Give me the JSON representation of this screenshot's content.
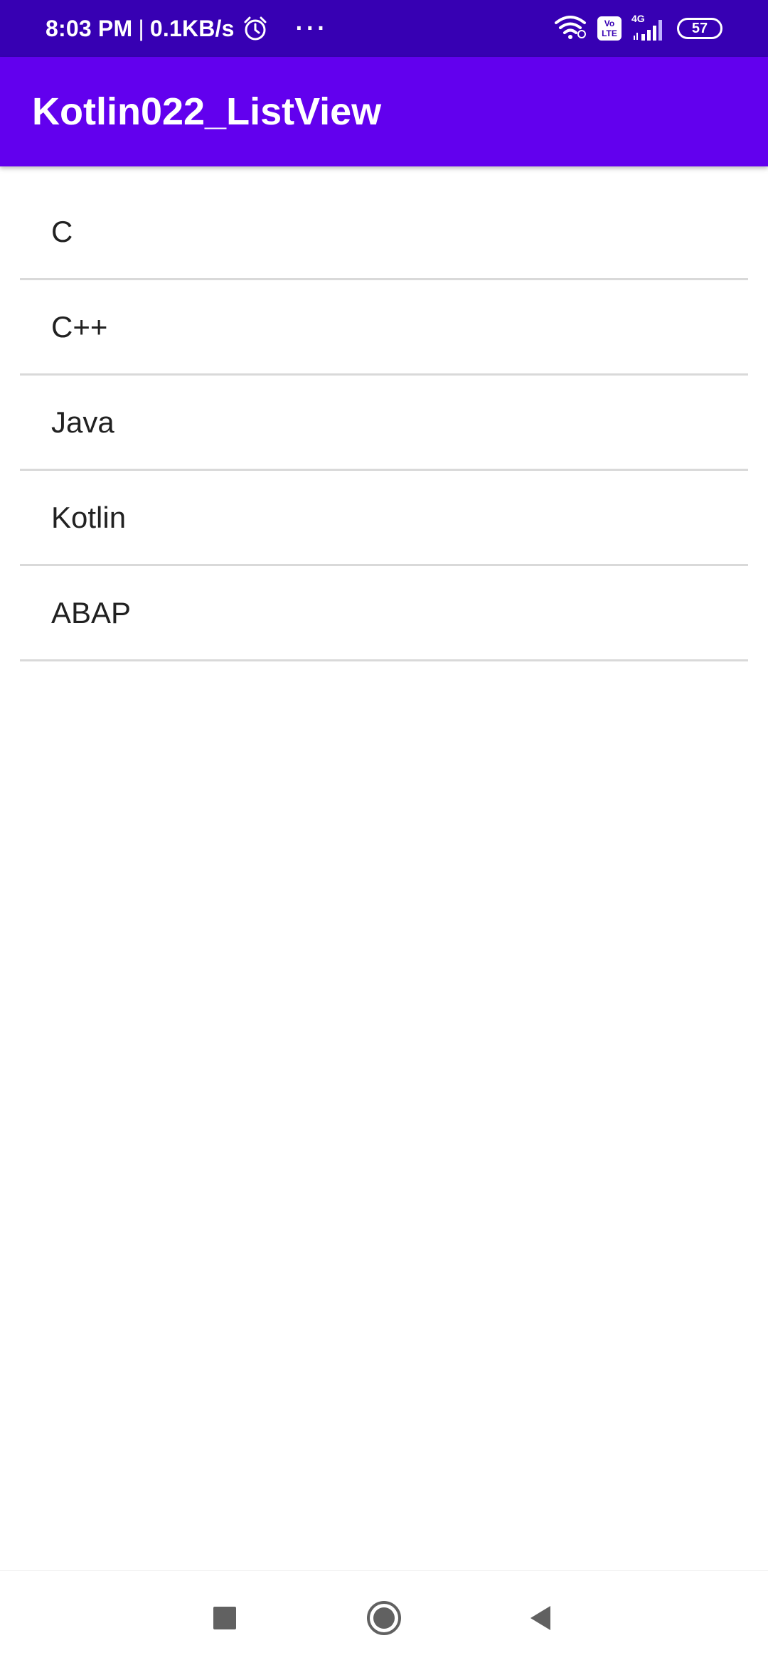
{
  "status_bar": {
    "time": "8:03 PM",
    "separator": "|",
    "net_speed": "0.1KB/s",
    "more_dots": "···",
    "volte_top": "Vo",
    "volte_bottom": "LTE",
    "network_type": "4G",
    "battery": "57",
    "icons": [
      "alarm-icon",
      "wifi-icon",
      "volte-icon",
      "signal-icon",
      "battery-icon"
    ]
  },
  "app_bar": {
    "title": "Kotlin022_ListView",
    "color": "#6200ee"
  },
  "list": {
    "items": [
      "C",
      "C++",
      "Java",
      "Kotlin",
      "ABAP"
    ]
  },
  "nav_bar": {
    "buttons": [
      "recents-button",
      "home-button",
      "back-button"
    ]
  },
  "colors": {
    "status_bar": "#3700b3",
    "app_bar": "#6200ee",
    "divider": "#d9d9d9",
    "text": "#212121"
  }
}
